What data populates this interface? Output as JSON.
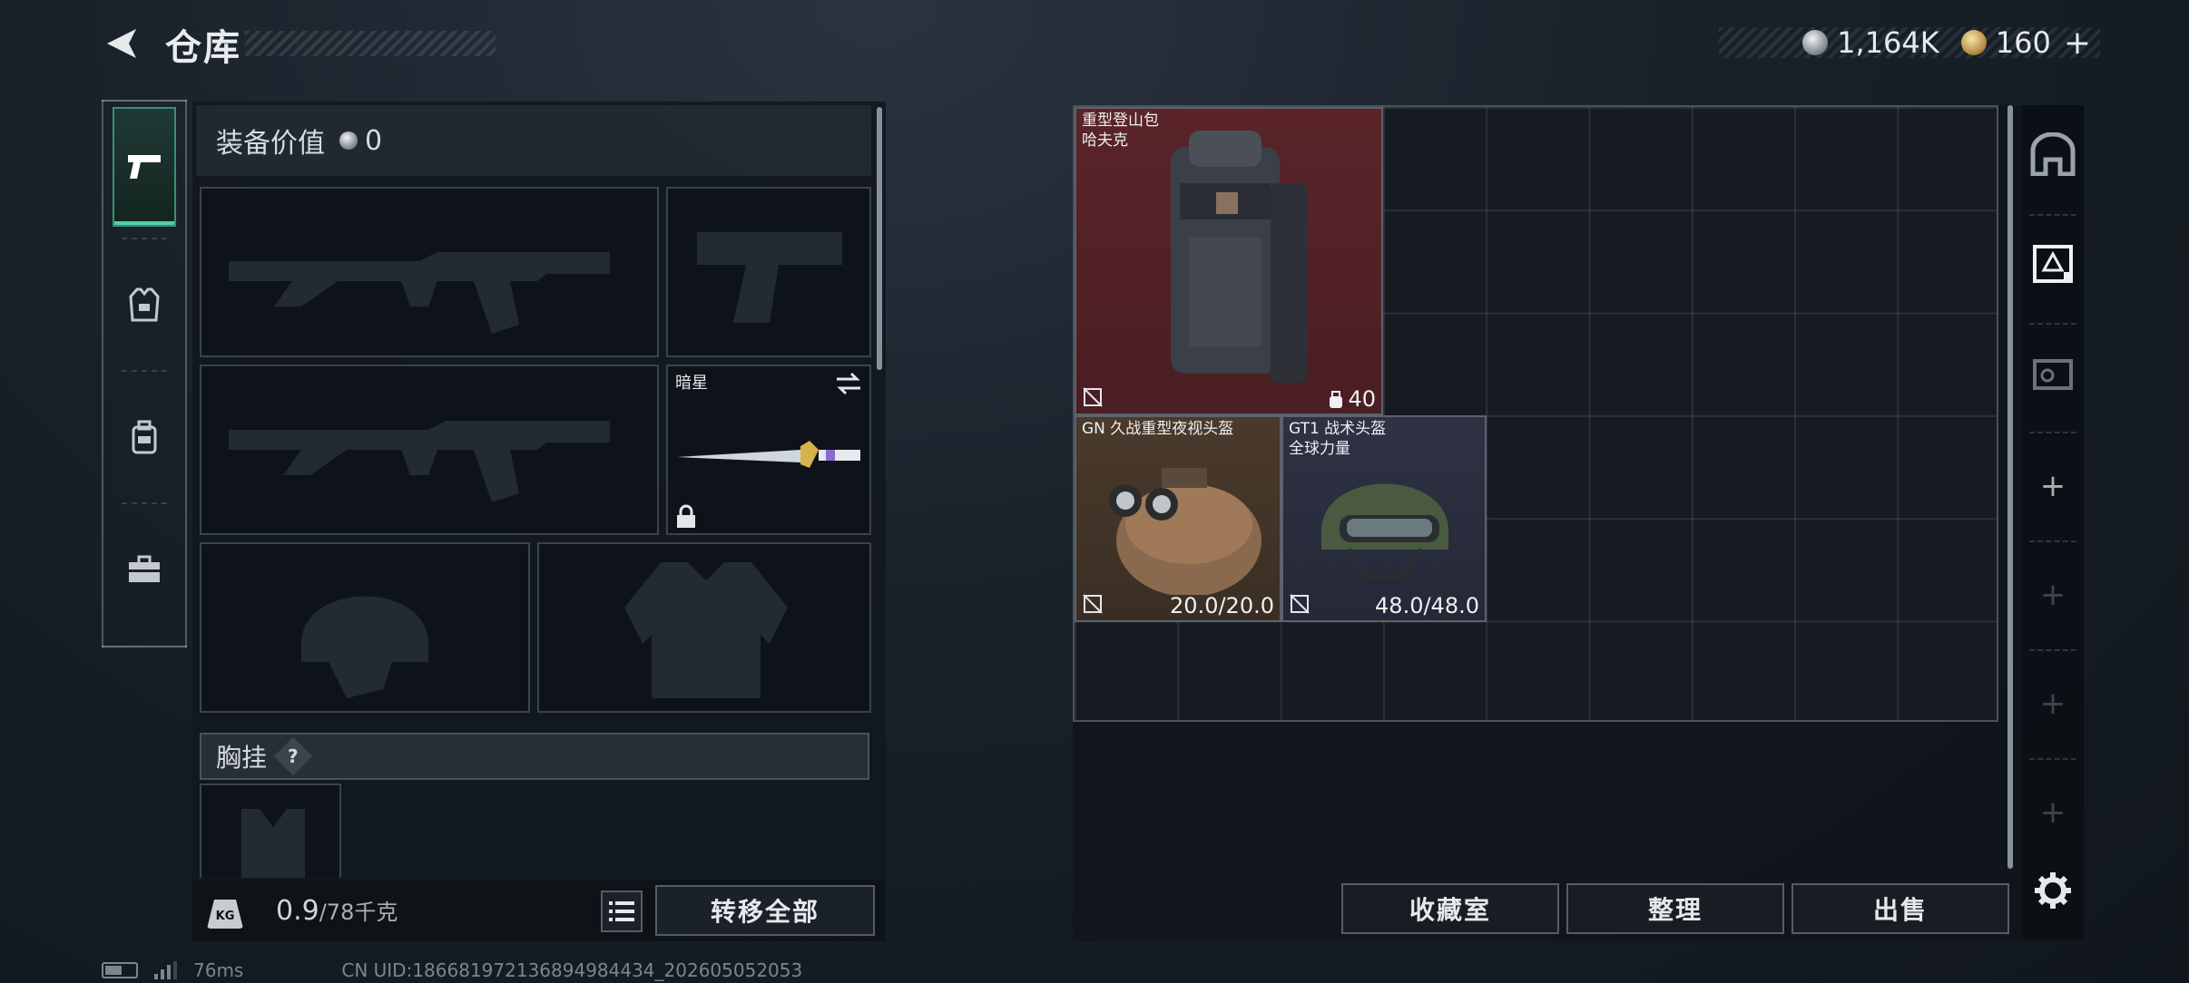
{
  "header": {
    "title": "仓库",
    "currency": [
      {
        "icon": "silver-coin-icon",
        "value": "1,164K"
      },
      {
        "icon": "gold-coin-icon",
        "value": "160"
      }
    ],
    "add_label": "+"
  },
  "rail": {
    "tabs": [
      {
        "icon": "pistol-icon",
        "active": true
      },
      {
        "icon": "armor-vest-icon",
        "active": false
      },
      {
        "icon": "backpack-icon",
        "active": false
      },
      {
        "icon": "toolbox-icon",
        "active": false
      }
    ]
  },
  "equipment": {
    "value_label": "装备价值",
    "value": "0",
    "slots": {
      "primary_weapon_1": "",
      "sidearm": "",
      "primary_weapon_2": "",
      "melee_name": "暗星",
      "helmet": "",
      "armor": ""
    },
    "chest_rig_label": "胸挂",
    "help_label": "?",
    "weight_icon_label": "KG",
    "weight_current": "0.9",
    "weight_max": "/78千克",
    "transfer_all_label": "转移全部"
  },
  "stash": {
    "items": [
      {
        "name_line1": "重型登山包",
        "name_line2": "哈夫克",
        "value": "40",
        "bg": "#5a2429"
      },
      {
        "name_line1": "GN 久战重型夜视头盔",
        "name_line2": "",
        "value": "20.0/20.0",
        "bg": "#4a3a2c"
      },
      {
        "name_line1": "GT1 战术头盔",
        "name_line2": "全球力量",
        "value": "48.0/48.0",
        "bg": "#2e3244"
      }
    ],
    "side_buttons": [
      {
        "icon": "safe-box-icon"
      },
      {
        "icon": "stash-tab-1-icon"
      },
      {
        "icon": "stash-tab-4-icon"
      }
    ],
    "plus_label": "+",
    "actions": {
      "collection": "收藏室",
      "organize": "整理",
      "sell": "出售"
    }
  },
  "status_bar": {
    "ping": "76ms",
    "uid": "CN UID:18668197213689498​4434_202605052053"
  }
}
